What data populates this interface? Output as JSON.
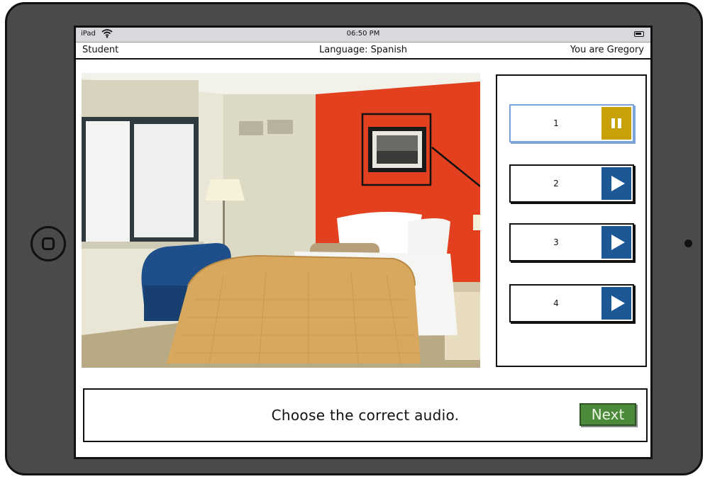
{
  "status_bar": {
    "carrier": "iPad",
    "time": "06:50 PM"
  },
  "header": {
    "role": "Student",
    "language": "Language: Spanish",
    "user": "You are Gregory"
  },
  "audio_options": [
    {
      "label": "1",
      "state": "pause"
    },
    {
      "label": "2",
      "state": "play"
    },
    {
      "label": "3",
      "state": "play"
    },
    {
      "label": "4",
      "state": "play"
    }
  ],
  "instruction": "Choose the correct audio.",
  "next_label": "Next",
  "colors": {
    "play": "#1c5796",
    "pause": "#c8a008",
    "next": "#4a8a3a",
    "wall_accent": "#e2401f"
  }
}
